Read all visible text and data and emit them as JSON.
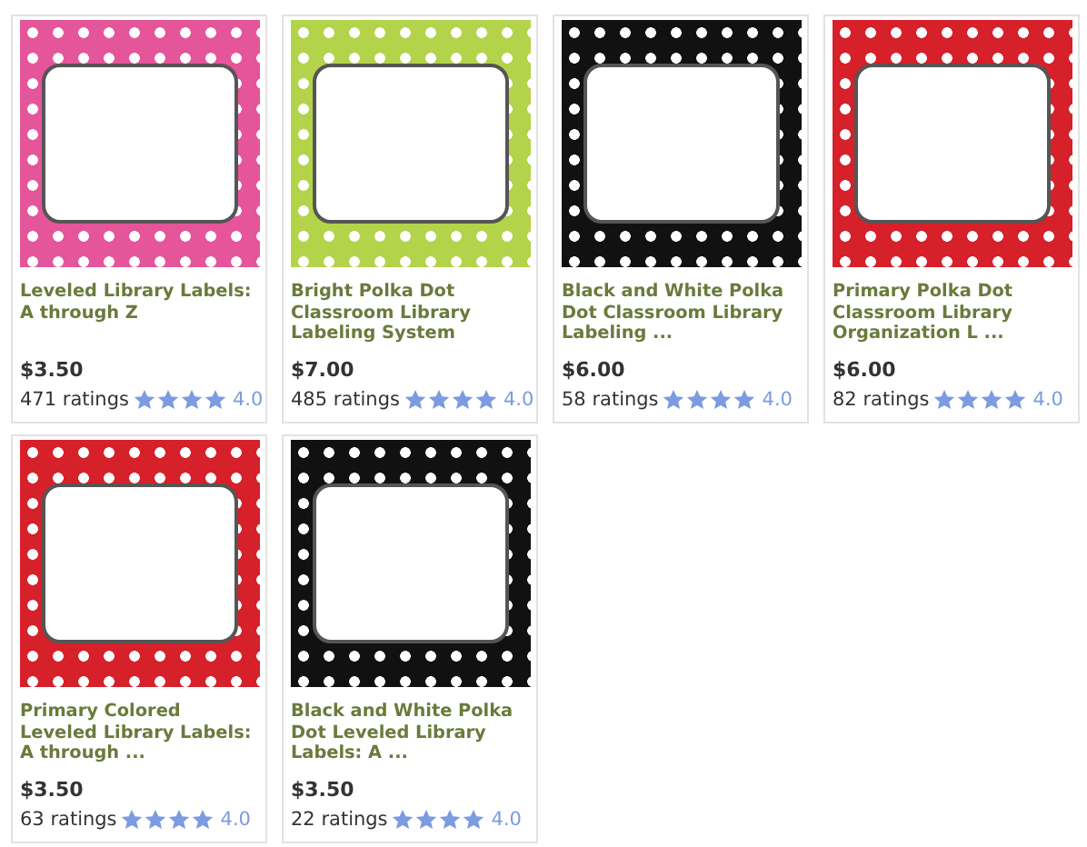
{
  "products": [
    {
      "title": "Leveled Library Labels: A through Z",
      "price": "$3.50",
      "ratings": "471 ratings",
      "stars": 4,
      "score": "4.0"
    },
    {
      "title": "Bright Polka Dot Classroom Library Labeling System",
      "price": "$7.00",
      "ratings": "485 ratings",
      "stars": 4,
      "score": "4.0"
    },
    {
      "title": "Black and White Polka Dot Classroom Library Labeling ...",
      "price": "$6.00",
      "ratings": "58 ratings",
      "stars": 4,
      "score": "4.0"
    },
    {
      "title": "Primary Polka Dot Classroom Library Organization L ...",
      "price": "$6.00",
      "ratings": "82 ratings",
      "stars": 4,
      "score": "4.0"
    },
    {
      "title": "Primary Colored Leveled Library Labels: A through ...",
      "price": "$3.50",
      "ratings": "63 ratings",
      "stars": 4,
      "score": "4.0"
    },
    {
      "title": "Black and White Polka Dot Leveled Library Labels: A ...",
      "price": "$3.50",
      "ratings": "22 ratings",
      "stars": 4,
      "score": "4.0"
    }
  ]
}
